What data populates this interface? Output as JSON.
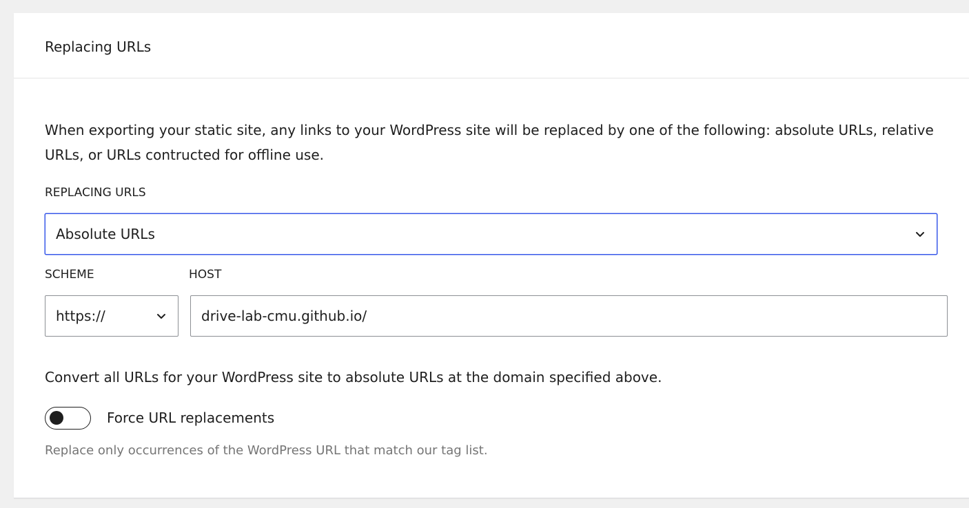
{
  "panel": {
    "title": "Replacing URLs",
    "description": "When exporting your static site, any links to your WordPress site will be replaced by one of the following: absolute URLs, relative URLs, or URLs contructed for offline use."
  },
  "replacing_urls": {
    "label": "REPLACING URLS",
    "selected": "Absolute URLs",
    "icon": "chevron-down-icon",
    "focus_color": "#3858e9"
  },
  "scheme": {
    "label": "SCHEME",
    "selected": "https://",
    "icon": "chevron-down-icon"
  },
  "host": {
    "label": "HOST",
    "value": "drive-lab-cmu.github.io/"
  },
  "convert_text": "Convert all URLs for your WordPress site to absolute URLs at the domain specified above.",
  "force_replacement": {
    "label": "Force URL replacements",
    "enabled": false,
    "help": "Replace only occurrences of the WordPress URL that match our tag list."
  }
}
